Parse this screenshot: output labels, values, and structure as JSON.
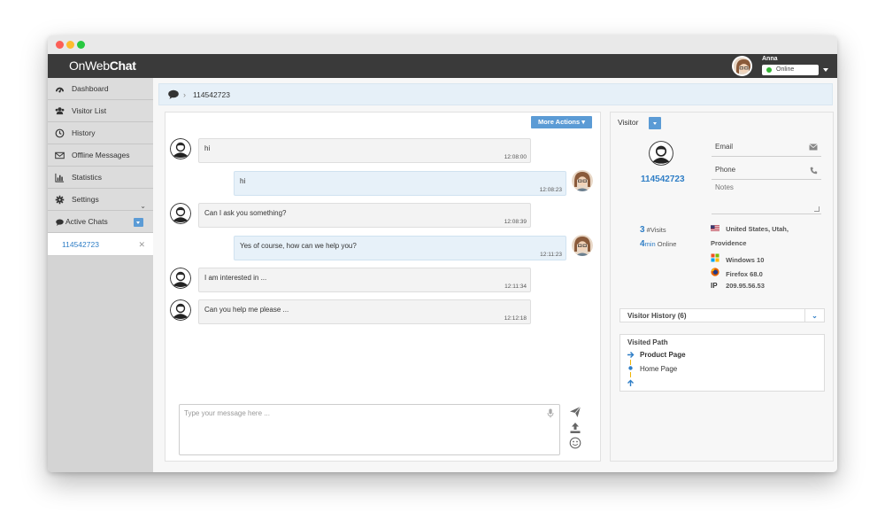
{
  "app": {
    "logo_light": "OnWeb",
    "logo_bold": "Chat",
    "agent_name": "Anna",
    "agent_status": "Online"
  },
  "sidebar": {
    "items": [
      {
        "label": "Dashboard",
        "icon": "dashboard-icon"
      },
      {
        "label": "Visitor List",
        "icon": "users-icon"
      },
      {
        "label": "History",
        "icon": "clock-icon"
      },
      {
        "label": "Offline Messages",
        "icon": "envelope-icon"
      },
      {
        "label": "Statistics",
        "icon": "bar-chart-icon"
      },
      {
        "label": "Settings",
        "icon": "gear-icon"
      }
    ],
    "active_chats_label": "Active Chats",
    "chats": [
      {
        "id": "114542723"
      }
    ]
  },
  "breadcrumb": {
    "label": "114542723"
  },
  "chat": {
    "more_actions": "More Actions",
    "messages": [
      {
        "from": "visitor",
        "text": "hi",
        "time": "12:08:00"
      },
      {
        "from": "agent",
        "text": "hi",
        "time": "12:08:23"
      },
      {
        "from": "visitor",
        "text": "Can I ask you something?",
        "time": "12:08:39"
      },
      {
        "from": "agent",
        "text": "Yes of course, how can we help you?",
        "time": "12:11:23"
      },
      {
        "from": "visitor",
        "text": "I am interested in ...",
        "time": "12:11:34"
      },
      {
        "from": "visitor",
        "text": "Can you help me please ...",
        "time": "12:12:18"
      }
    ],
    "input_placeholder": "Type your message here ..."
  },
  "visitor": {
    "title": "Visitor",
    "id": "114542723",
    "email_label": "Email",
    "phone_label": "Phone",
    "notes_label": "Notes",
    "visits_count": "3",
    "visits_label": "#Visits",
    "online_value": "4",
    "online_unit": "min",
    "online_label": "Online",
    "location": "United States, Utah,",
    "location_city": "Providence",
    "os": "Windows 10",
    "browser": "Firefox 68.0",
    "ip_label": "IP",
    "ip": "209.95.56.53",
    "history_label": "Visitor History (6)",
    "visited_path_title": "Visited Path",
    "path": [
      "Product Page",
      "Home Page"
    ]
  },
  "colors": {
    "accent": "#5b9bd5",
    "link": "#2f7ec6",
    "topbar": "#3a3a3a",
    "status_online": "#34b234"
  }
}
